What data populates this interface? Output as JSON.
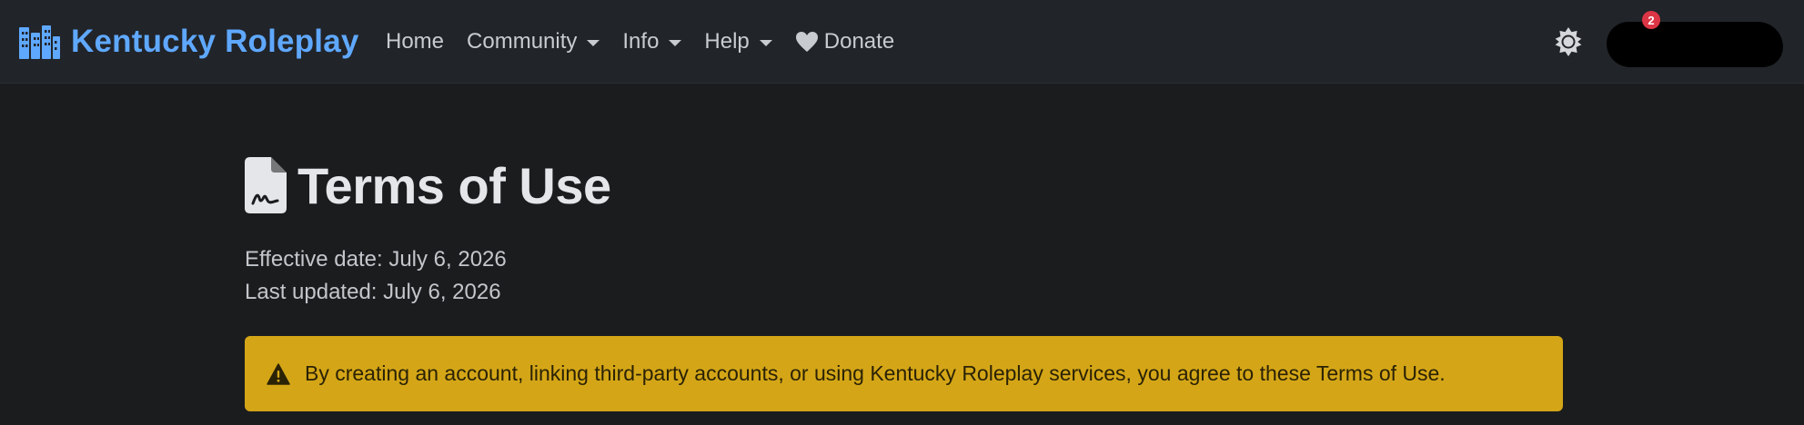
{
  "navbar": {
    "brand": "Kentucky Roleplay",
    "links": [
      {
        "label": "Home",
        "dropdown": false
      },
      {
        "label": "Community",
        "dropdown": true
      },
      {
        "label": "Info",
        "dropdown": true
      },
      {
        "label": "Help",
        "dropdown": true
      },
      {
        "label": "Donate",
        "dropdown": false,
        "icon": "heart-icon"
      }
    ],
    "theme_icon": "sun-icon",
    "notification_count": "2"
  },
  "page": {
    "icon": "file-signature-icon",
    "title": "Terms of Use",
    "effective_date": "Effective date: July 6, 2026",
    "last_updated": "Last updated: July 6, 2026"
  },
  "alert": {
    "icon": "warning-icon",
    "text": "By creating an account, linking third-party accounts, or using Kentucky Roleplay services, you agree to these Terms of Use."
  },
  "colors": {
    "brand": "#5fa8ff",
    "navbar_bg": "#212429",
    "page_bg": "#1b1c1e",
    "alert_bg": "#d4a617",
    "badge": "#dc3545"
  }
}
